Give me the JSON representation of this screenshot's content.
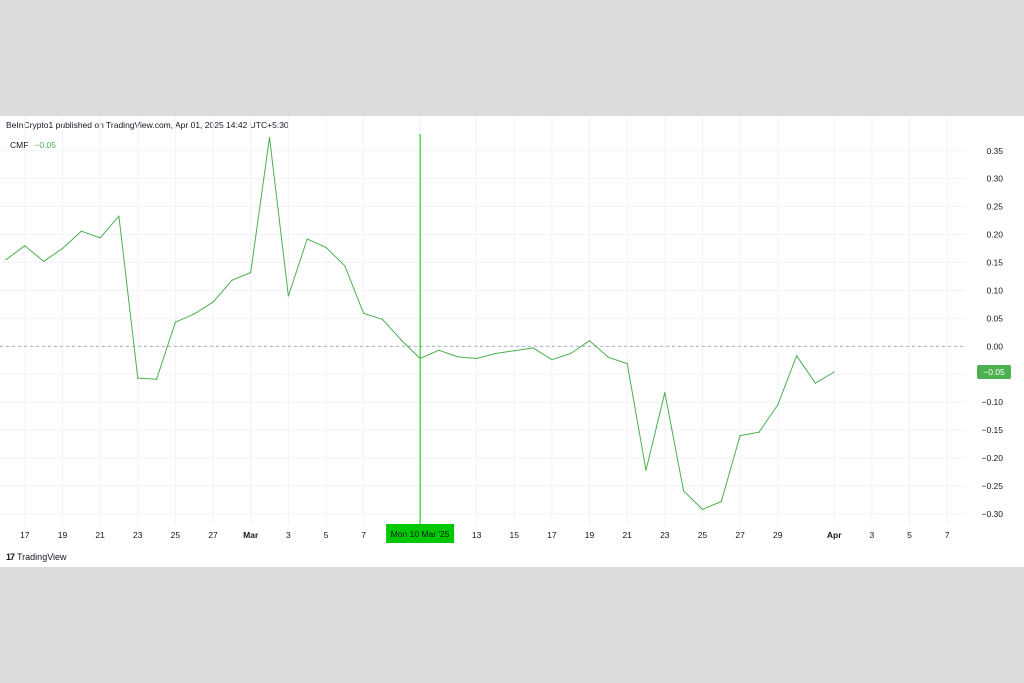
{
  "header": {
    "published_text": "BeInCrypto1 published on TradingView.com, Apr 01, 2025 14:42 UTC+5:30"
  },
  "legend": {
    "indicator": "CMF",
    "value": "−0.05"
  },
  "crosshair": {
    "label": "Mon 10 Mar '25",
    "color": "#00c800"
  },
  "price_label": {
    "text": "−0.05",
    "color": "#4caf50"
  },
  "footer": {
    "logo_mark": "17",
    "logo_text": "TradingView"
  },
  "colors": {
    "line": "#4caf50",
    "grid": "#f0f3fa",
    "zero_line": "#9598a1",
    "axis_text": "#131722"
  },
  "chart_data": {
    "type": "line",
    "title": "",
    "xlabel": "",
    "ylabel": "",
    "ylim": [
      -0.32,
      0.38
    ],
    "y_ticks": [
      "0.35",
      "0.30",
      "0.25",
      "0.20",
      "0.15",
      "0.10",
      "0.05",
      "0.00",
      "−0.10",
      "−0.15",
      "−0.20",
      "−0.25",
      "−0.30"
    ],
    "y_tick_values": [
      0.35,
      0.3,
      0.25,
      0.2,
      0.15,
      0.1,
      0.05,
      0.0,
      -0.1,
      -0.15,
      -0.2,
      -0.25,
      -0.3
    ],
    "x_ticks": [
      "17",
      "19",
      "21",
      "23",
      "25",
      "27",
      "Mar",
      "3",
      "5",
      "7",
      "Mon 10 Mar '25",
      "13",
      "15",
      "17",
      "19",
      "21",
      "23",
      "25",
      "27",
      "29",
      "Apr",
      "3",
      "5",
      "7"
    ],
    "x_tick_dates": [
      "2025-02-17",
      "2025-02-19",
      "2025-02-21",
      "2025-02-23",
      "2025-02-25",
      "2025-02-27",
      "2025-03-01",
      "2025-03-03",
      "2025-03-05",
      "2025-03-07",
      "2025-03-10",
      "2025-03-13",
      "2025-03-15",
      "2025-03-17",
      "2025-03-19",
      "2025-03-21",
      "2025-03-23",
      "2025-03-25",
      "2025-03-27",
      "2025-03-29",
      "2025-04-01",
      "2025-04-03",
      "2025-04-05",
      "2025-04-07"
    ],
    "x_range": [
      "2025-02-16",
      "2025-04-08"
    ],
    "zero_line": 0,
    "grid": true,
    "series": [
      {
        "x": [
          "2025-02-16",
          "2025-02-17",
          "2025-02-18",
          "2025-02-19",
          "2025-02-20",
          "2025-02-21",
          "2025-02-22",
          "2025-02-23",
          "2025-02-24",
          "2025-02-25",
          "2025-02-26",
          "2025-02-27",
          "2025-02-28",
          "2025-03-01",
          "2025-03-02",
          "2025-03-03",
          "2025-03-04",
          "2025-03-05",
          "2025-03-06",
          "2025-03-07",
          "2025-03-08",
          "2025-03-09",
          "2025-03-10",
          "2025-03-11",
          "2025-03-12",
          "2025-03-13",
          "2025-03-14",
          "2025-03-15",
          "2025-03-16",
          "2025-03-17",
          "2025-03-18",
          "2025-03-19",
          "2025-03-20",
          "2025-03-21",
          "2025-03-22",
          "2025-03-23",
          "2025-03-24",
          "2025-03-25",
          "2025-03-26",
          "2025-03-27",
          "2025-03-28",
          "2025-03-29",
          "2025-03-30",
          "2025-03-31",
          "2025-04-01"
        ],
        "values": [
          0.155,
          0.18,
          0.152,
          0.175,
          0.206,
          0.194,
          0.233,
          -0.057,
          -0.059,
          0.043,
          0.058,
          0.079,
          0.118,
          0.132,
          0.374,
          0.09,
          0.192,
          0.177,
          0.144,
          0.059,
          0.048,
          0.011,
          -0.022,
          -0.007,
          -0.019,
          -0.022,
          -0.013,
          -0.008,
          -0.003,
          -0.024,
          -0.013,
          0.01,
          -0.02,
          -0.031,
          -0.222,
          -0.083,
          -0.259,
          -0.292,
          -0.278,
          -0.16,
          -0.154,
          -0.105,
          -0.017,
          -0.066,
          -0.046
        ]
      }
    ]
  }
}
